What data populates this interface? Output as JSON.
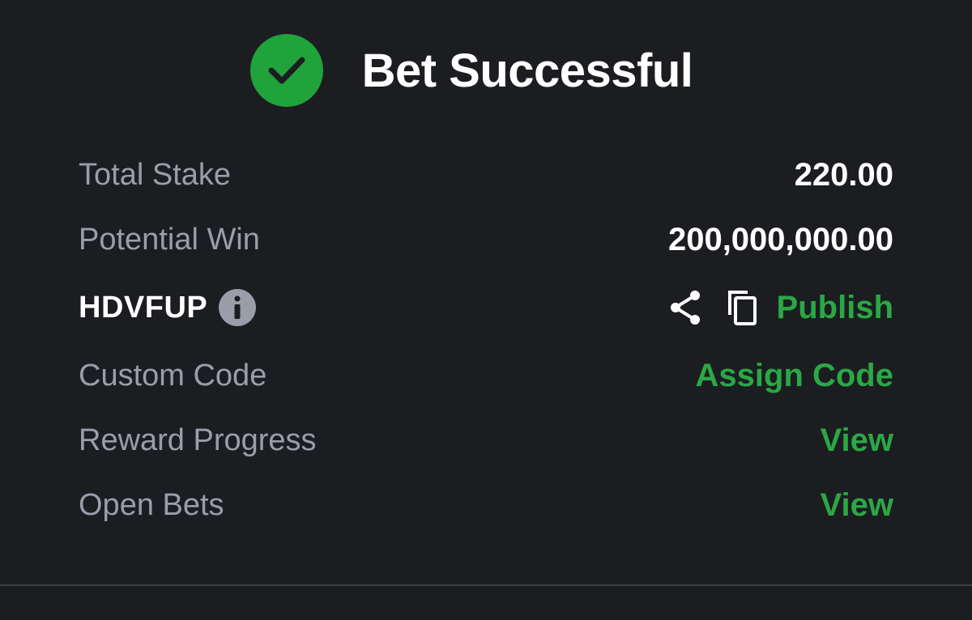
{
  "header": {
    "title": "Bet Successful",
    "icon": "check-circle-icon",
    "icon_color": "#1fa33a"
  },
  "summary": {
    "total_stake_label": "Total Stake",
    "total_stake_value": "220.00",
    "potential_win_label": "Potential Win",
    "potential_win_value": "200,000,000.00",
    "booking_code": "HDVFUP",
    "publish_label": "Publish",
    "custom_code_label": "Custom Code",
    "assign_code_label": "Assign Code",
    "reward_progress_label": "Reward Progress",
    "reward_progress_link": "View",
    "open_bets_label": "Open Bets",
    "open_bets_link": "View"
  },
  "colors": {
    "background": "#1c1d21",
    "accent_green": "#2aa845",
    "label_gray": "#9a9ea8"
  }
}
